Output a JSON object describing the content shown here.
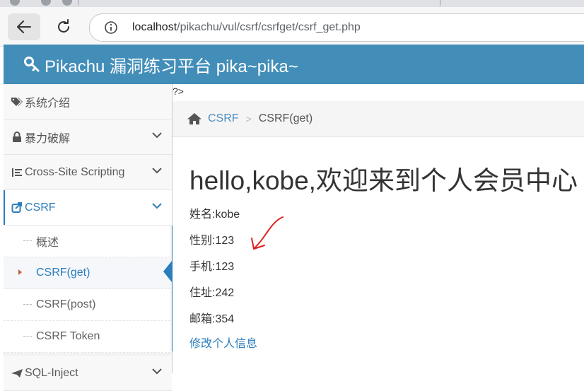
{
  "browser": {
    "url_host": "localhost",
    "url_path": "/pikachu/vul/csrf/csrfget/csrf_get.php"
  },
  "app": {
    "title": "Pikachu 漏洞练习平台 pika~pika~"
  },
  "sidebar": {
    "items": [
      {
        "label": "系统介绍",
        "icon": "tags-icon"
      },
      {
        "label": "暴力破解",
        "icon": "lock-icon"
      },
      {
        "label": "Cross-Site Scripting",
        "icon": "list-icon"
      },
      {
        "label": "CSRF",
        "icon": "share-icon"
      },
      {
        "label": "SQL-Inject",
        "icon": "plane-icon"
      }
    ],
    "csrf_submenu": [
      {
        "label": "概述"
      },
      {
        "label": "CSRF(get)"
      },
      {
        "label": "CSRF(post)"
      },
      {
        "label": "CSRF Token"
      }
    ]
  },
  "main": {
    "stray_text": "?>",
    "breadcrumb": {
      "link": "CSRF",
      "current": "CSRF(get)"
    },
    "welcome": "hello,kobe,欢迎来到个人会员中心",
    "fields": [
      "姓名:kobe",
      "性别:123",
      "手机:123",
      "住址:242",
      "邮箱:354"
    ],
    "edit_link": "修改个人信息"
  },
  "colors": {
    "header": "#438eb9",
    "accent": "#2b7dbc",
    "annotation": "#e02020"
  }
}
